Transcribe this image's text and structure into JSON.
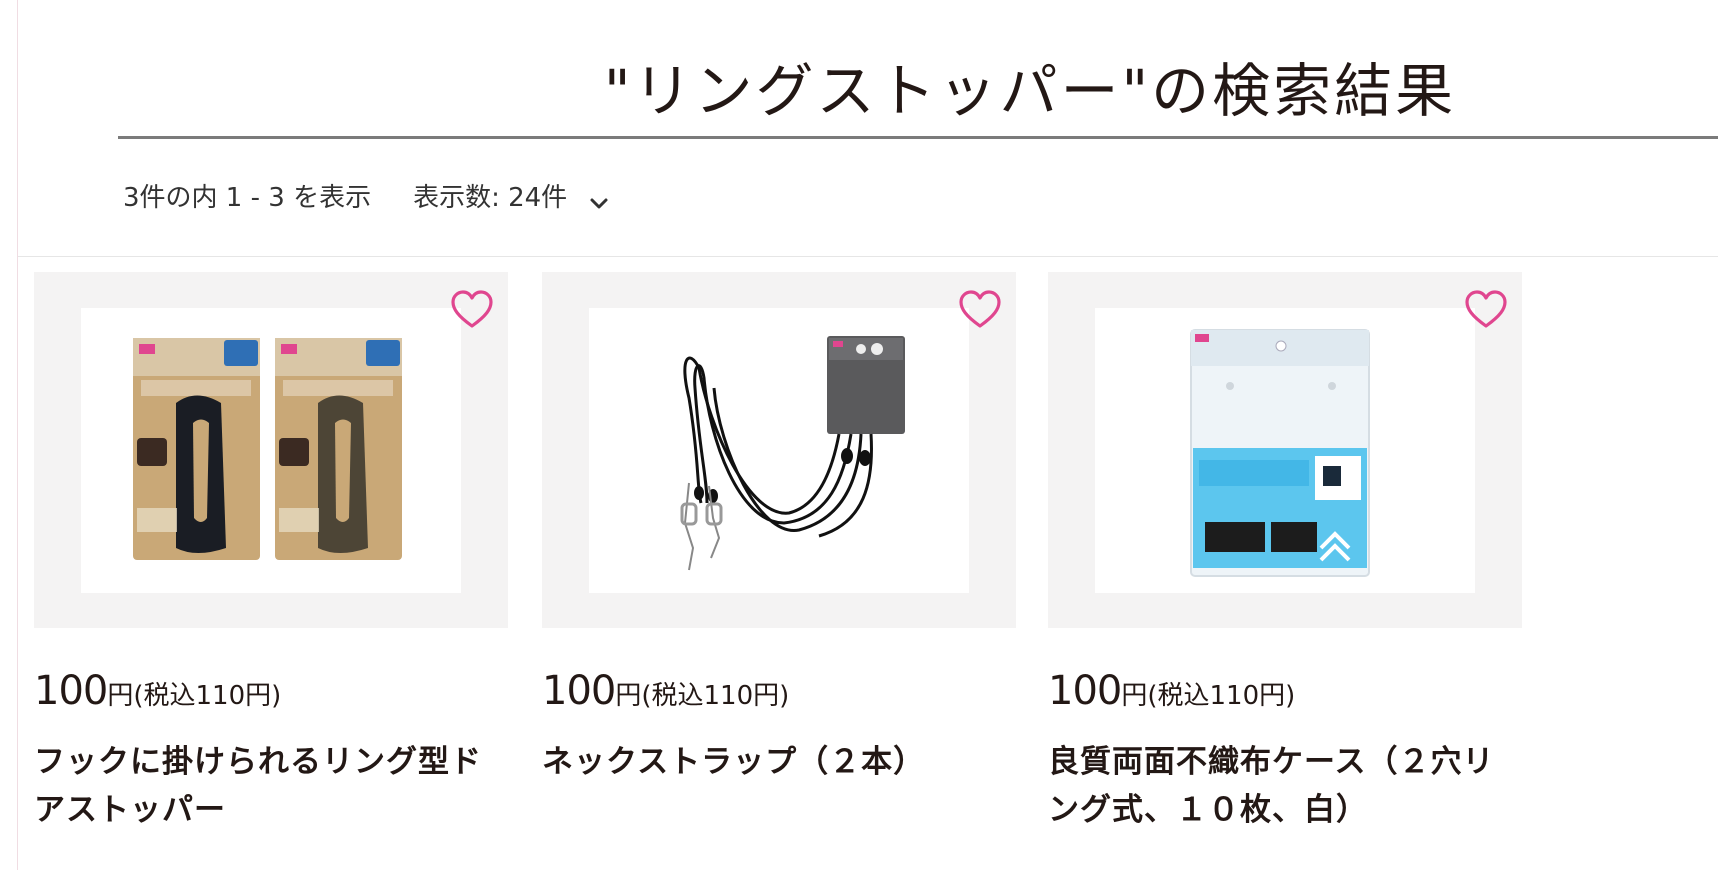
{
  "page": {
    "title": "\"リングストッパー\"の検索結果"
  },
  "results": {
    "summary": "3件の内 1 - 3 を表示",
    "per_page_label": "表示数: 24件"
  },
  "colors": {
    "accent_pink": "#e0468f",
    "text_dark": "#231815",
    "thumb_bg": "#f4f3f3"
  },
  "icons": {
    "favorite": "heart-outline-icon",
    "dropdown": "chevron-down-icon"
  },
  "products": [
    {
      "price": "100",
      "price_unit": "円",
      "price_tax": "(税込110円)",
      "name": "フックに掛けられるリング型ドアストッパー"
    },
    {
      "price": "100",
      "price_unit": "円",
      "price_tax": "(税込110円)",
      "name": "ネックストラップ（２本）"
    },
    {
      "price": "100",
      "price_unit": "円",
      "price_tax": "(税込110円)",
      "name": "良質両面不織布ケース（２穴リング式、１０枚、白）"
    }
  ]
}
